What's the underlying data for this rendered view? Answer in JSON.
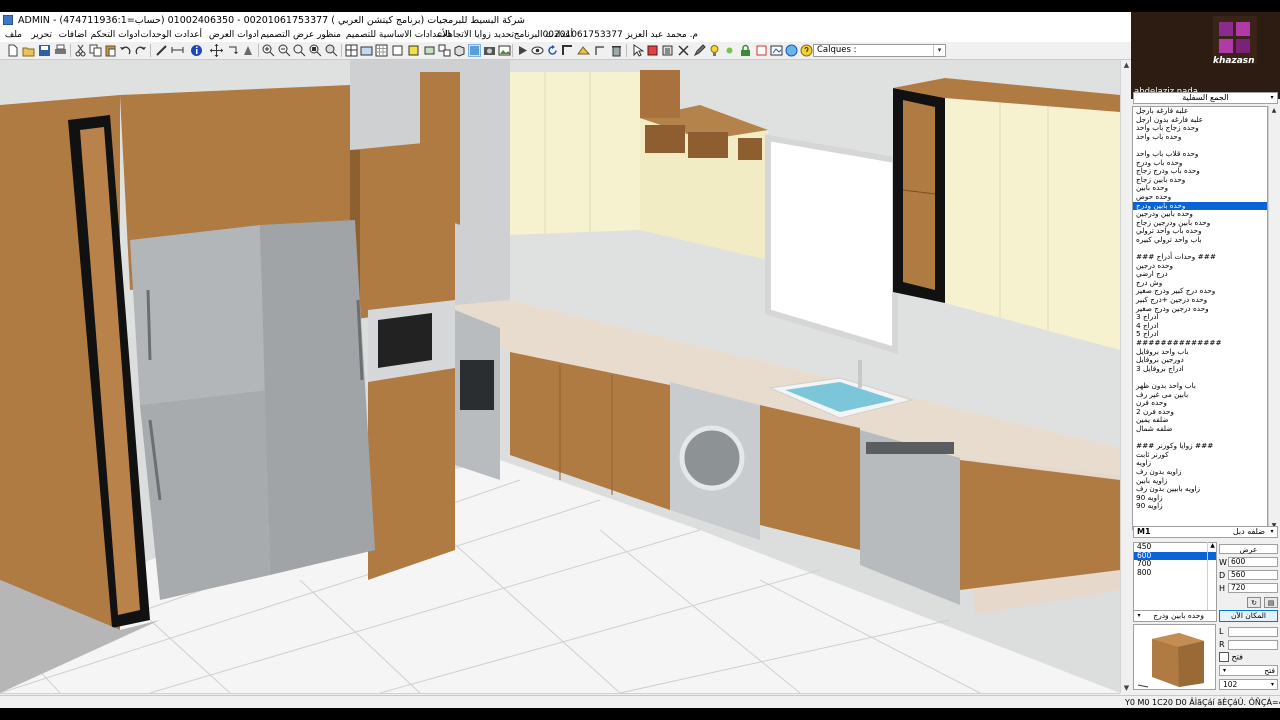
{
  "window": {
    "title": "ADMIN - شركة البسيط للبرمجيات (برنامج كيتشن العربي ) 00201061753377 - 01002406350 (حساب=474711936:1)"
  },
  "menu": {
    "items": [
      "ملف",
      "تحرير",
      "اضافات",
      "ادوات التحكم",
      "أعدادت الوحدات",
      "ادوات العرض",
      "منظور عرض التصميم",
      "الأعدادات الاساسية للتصميم",
      "تحديد زوايا الاتجاهات",
      "أعدادت البرنامج",
      "م. محمد عبد العزيز 00201061753377"
    ]
  },
  "toolbar": {
    "calques_label": "Calques :"
  },
  "webcam": {
    "name": "abdelaziz nada",
    "logo_text": "khazasn"
  },
  "catalog": {
    "category": "الجمع السفلية",
    "items": [
      "علبه فارغه بارجل",
      "علبه فارغه بدون ارجل",
      "وحده زجاج باب واحد",
      "وحده باب واحد",
      "",
      "وحده قلاب باب واحد",
      "وحده باب ودرج",
      "وحده باب ودرج زجاج",
      "وحده بابين زجاج",
      "وحده بابين",
      "وحده حوض",
      "وحده بابين ودرج",
      "وحده بابين ودرجين",
      "وحده بابين ودرجين زجاج",
      "وحده باب واحد ترولي",
      "باب واحد ترولي كبيره",
      "",
      "### وحدات أدراج ###",
      "وحده درجين",
      "درج ارضي",
      "وش درج",
      "وحده درج كبير ودرج صغير",
      "وحده درجين +درج كبير",
      "وحده درجين ودرج صغير",
      "ادراج 3",
      "ادراج 4",
      "ادراج 5",
      "##############",
      "باب واحد بروفايل",
      "دورجين بروفايل",
      "ادراج بروفايل 3",
      "",
      "باب واحد بدون ظهر",
      "بابين مى غير رف",
      "وحده فرن",
      "وحده فرن 2",
      "ضلفه يمين",
      "ضلفه شمال",
      "",
      "### زوايا وكورنر ###",
      "كورنر ثابت",
      "زاويه",
      "زاويه بدون رف",
      "زاويه بابين",
      "زاويه بابيين بدون رف",
      "زاويه 90",
      "زاويه 90"
    ],
    "selected_index": 11
  },
  "subtype": {
    "code": "M1",
    "label": "ضلفه دبل"
  },
  "sizes": {
    "items": [
      "450",
      "600",
      "700",
      "800"
    ],
    "selected_index": 1
  },
  "dimensions": {
    "header": "عرض",
    "w_label": "W",
    "w_value": "600",
    "d_label": "D",
    "d_value": "560",
    "h_label": "H",
    "h_value": "720"
  },
  "unit_select": {
    "value": "وحده بابين ودرج"
  },
  "place_button": {
    "label": "المكان الآن"
  },
  "lr": {
    "l_label": "L",
    "r_label": "R"
  },
  "options": {
    "checkbox_label": "فتح",
    "select_value": "فتح",
    "number_value": "102"
  },
  "statusbar": {
    "text": "Y0 M0 1C20 D0 ÂÌãÇáí ãÈÇáÛ. ÔÑÇÁ=400 $"
  },
  "colors": {
    "wood": "#b07a43",
    "wood_dark": "#8e5f30",
    "steel": "#a7abae",
    "counter": "#e6d9cc",
    "wall": "#dddedf",
    "cream": "#f4f0cc",
    "selection": "#0a64d8"
  }
}
